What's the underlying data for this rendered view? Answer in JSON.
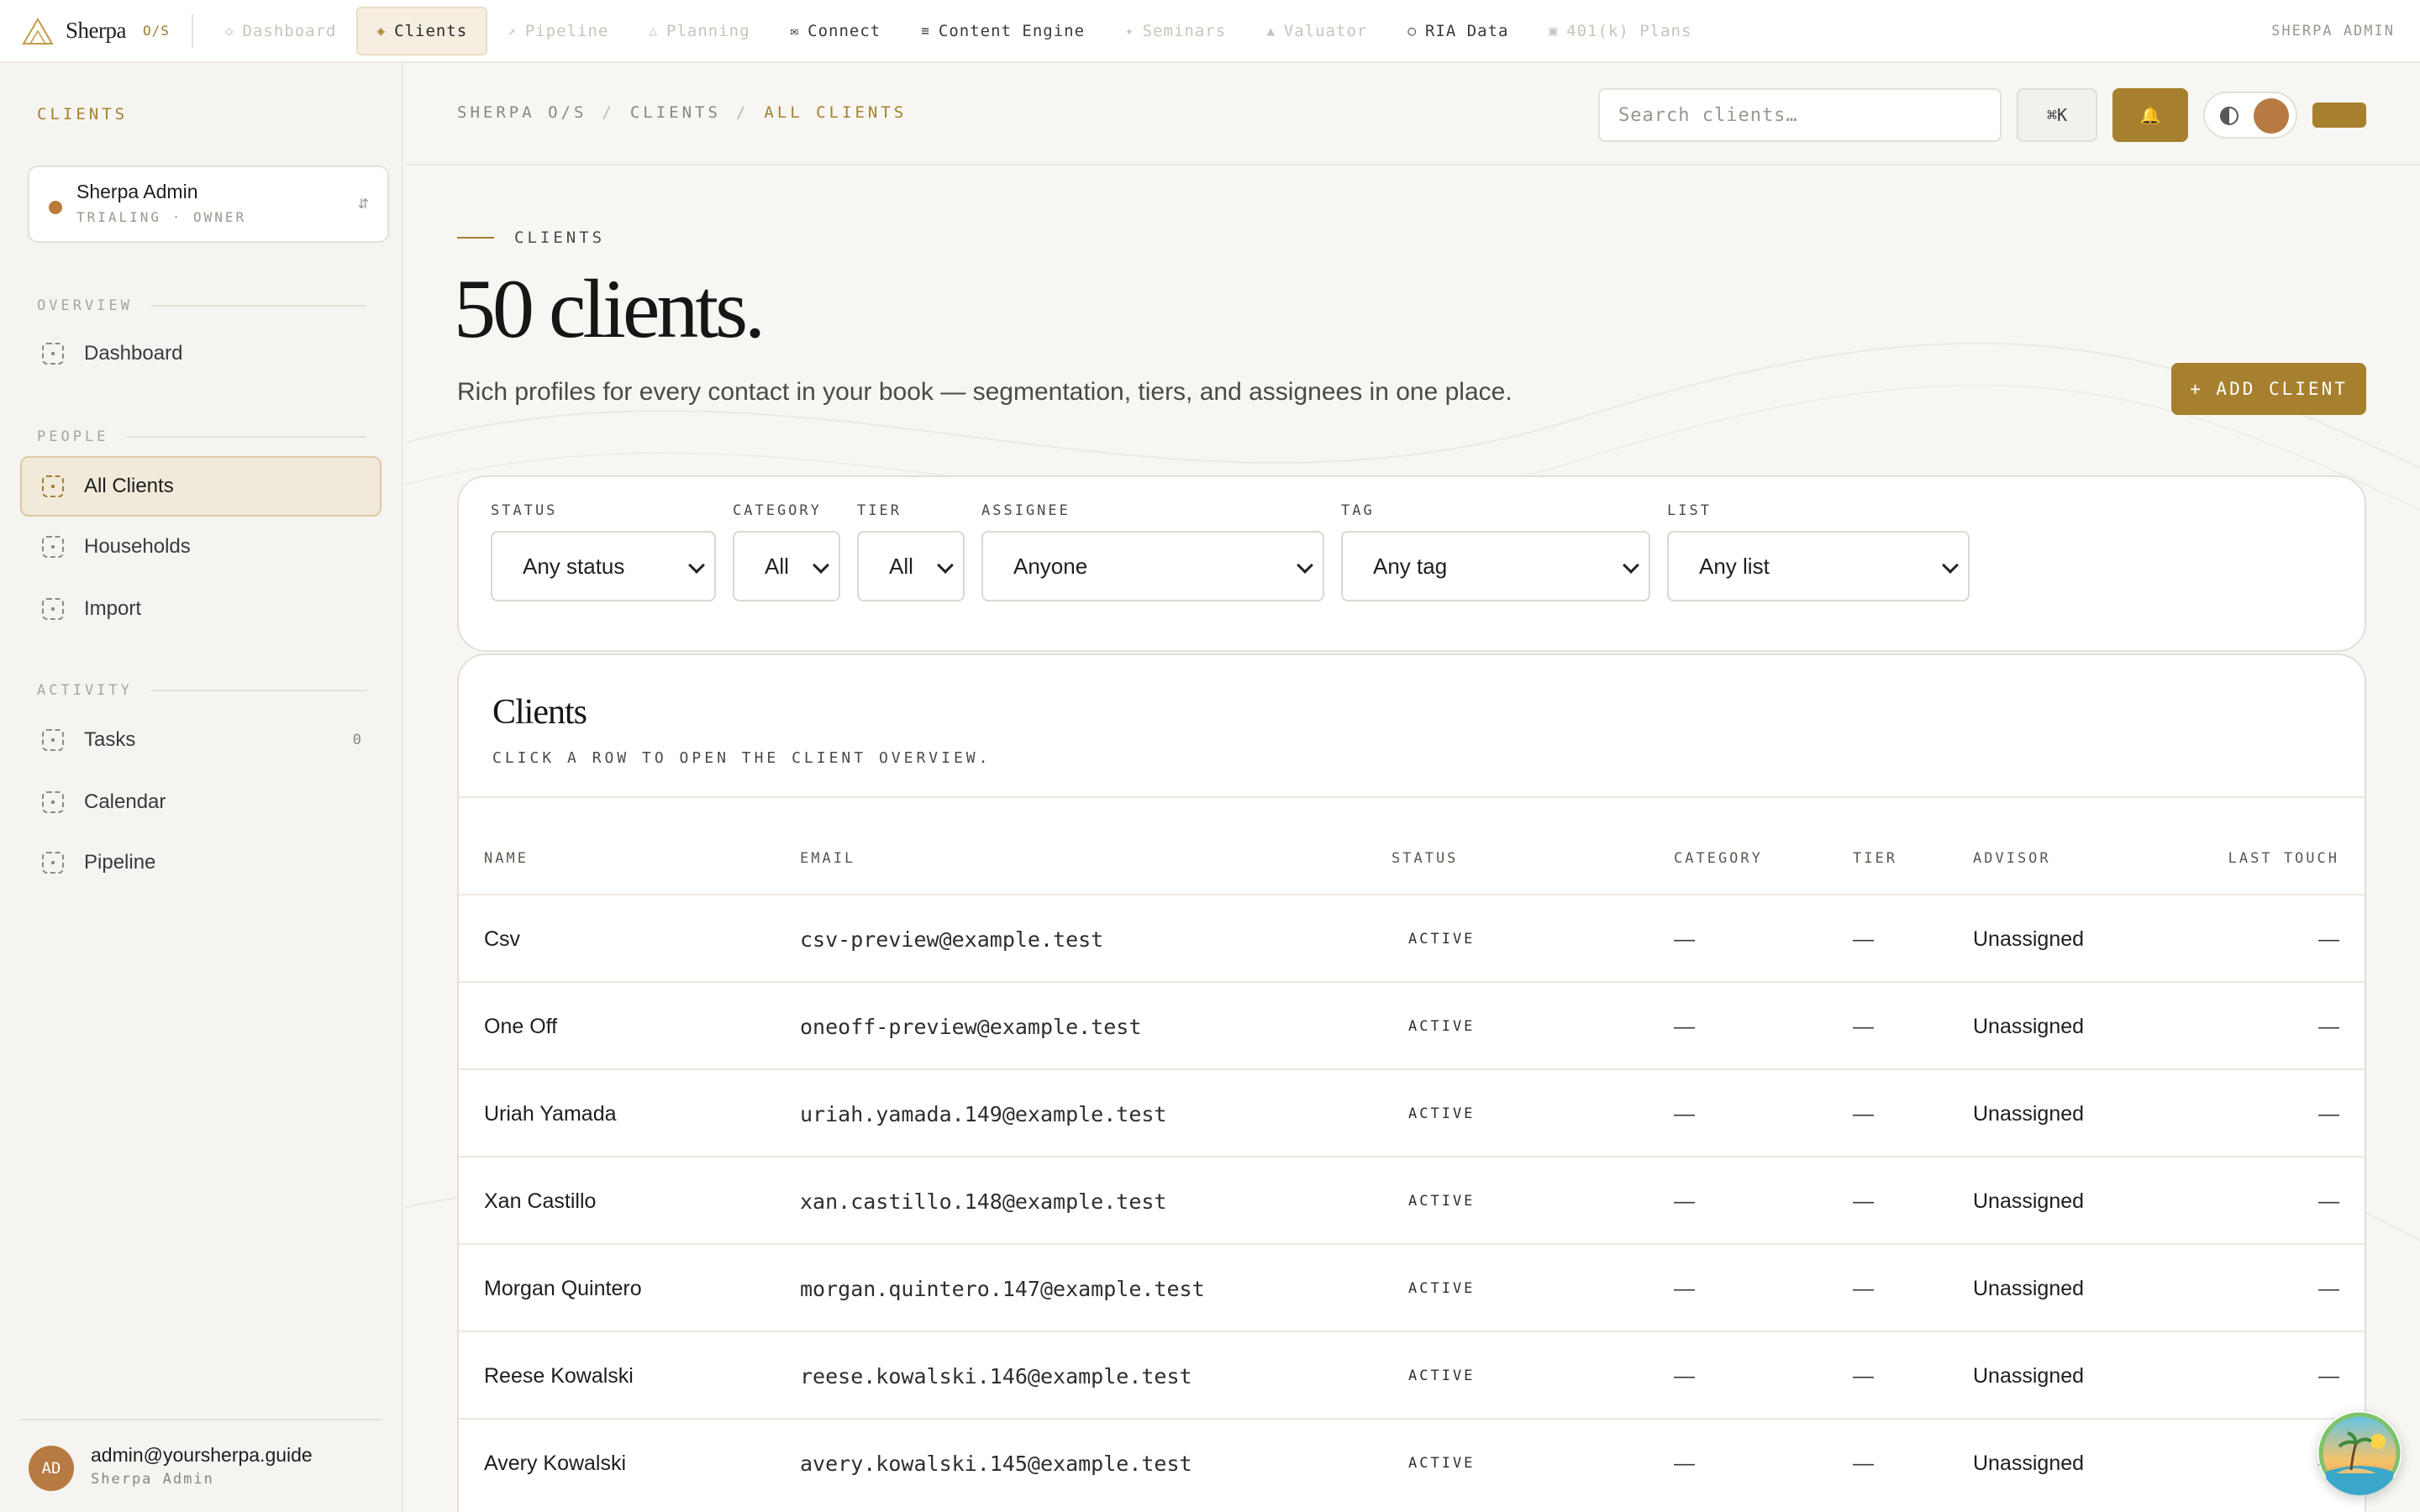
{
  "brand": {
    "name": "Sherpa",
    "tag": "O/S"
  },
  "topnav": [
    {
      "label": "Dashboard",
      "icon": "◇",
      "state": "disabled"
    },
    {
      "label": "Clients",
      "icon": "◈",
      "state": "active"
    },
    {
      "label": "Pipeline",
      "icon": "↗",
      "state": "disabled"
    },
    {
      "label": "Planning",
      "icon": "△",
      "state": "disabled"
    },
    {
      "label": "Connect",
      "icon": "✉",
      "state": "enabled"
    },
    {
      "label": "Content Engine",
      "icon": "≡",
      "state": "enabled"
    },
    {
      "label": "Seminars",
      "icon": "✦",
      "state": "disabled"
    },
    {
      "label": "Valuator",
      "icon": "▲",
      "state": "disabled"
    },
    {
      "label": "RIA Data",
      "icon": "○",
      "state": "enabled"
    },
    {
      "label": "401(k) Plans",
      "icon": "▣",
      "state": "disabled"
    }
  ],
  "top_user": "SHERPA ADMIN",
  "sidebar": {
    "title": "CLIENTS",
    "org": {
      "name": "Sherpa Admin",
      "sub": "TRIALING · OWNER",
      "switch_icon": "⇵"
    },
    "sections": {
      "overview": "OVERVIEW",
      "people": "PEOPLE",
      "activity": "ACTIVITY"
    },
    "items": {
      "dashboard": "Dashboard",
      "all_clients": "All Clients",
      "households": "Households",
      "import": "Import",
      "tasks": "Tasks",
      "tasks_count": "0",
      "calendar": "Calendar",
      "pipeline": "Pipeline"
    },
    "footer": {
      "initials": "AD",
      "email": "admin@yoursherpa.guide",
      "role": "Sherpa Admin"
    }
  },
  "breadcrumb": [
    "SHERPA O/S",
    "CLIENTS",
    "ALL CLIENTS"
  ],
  "search": {
    "placeholder": "Search clients…"
  },
  "kbd": "⌘K",
  "bell": "🔔",
  "hero": {
    "eyebrow": "CLIENTS",
    "title": "50 clients.",
    "subtitle": "Rich profiles for every contact in your book — segmentation, tiers, and assignees in one place.",
    "add_button": "+ ADD CLIENT"
  },
  "filters": {
    "status": {
      "label": "STATUS",
      "value": "Any status"
    },
    "category": {
      "label": "CATEGORY",
      "value": "All"
    },
    "tier": {
      "label": "TIER",
      "value": "All"
    },
    "assignee": {
      "label": "ASSIGNEE",
      "value": "Anyone"
    },
    "tag": {
      "label": "TAG",
      "value": "Any tag"
    },
    "list": {
      "label": "LIST",
      "value": "Any list"
    }
  },
  "table": {
    "title": "Clients",
    "hint": "CLICK A ROW TO OPEN THE CLIENT OVERVIEW.",
    "columns": {
      "name": "NAME",
      "email": "EMAIL",
      "status": "STATUS",
      "category": "CATEGORY",
      "tier": "TIER",
      "advisor": "ADVISOR",
      "last_touch": "LAST TOUCH"
    },
    "rows": [
      {
        "name": "Csv",
        "email": "csv-preview@example.test",
        "status": "ACTIVE",
        "category": "—",
        "tier": "—",
        "advisor": "Unassigned",
        "last_touch": "—"
      },
      {
        "name": "One Off",
        "email": "oneoff-preview@example.test",
        "status": "ACTIVE",
        "category": "—",
        "tier": "—",
        "advisor": "Unassigned",
        "last_touch": "—"
      },
      {
        "name": "Uriah Yamada",
        "email": "uriah.yamada.149@example.test",
        "status": "ACTIVE",
        "category": "—",
        "tier": "—",
        "advisor": "Unassigned",
        "last_touch": "—"
      },
      {
        "name": "Xan Castillo",
        "email": "xan.castillo.148@example.test",
        "status": "ACTIVE",
        "category": "—",
        "tier": "—",
        "advisor": "Unassigned",
        "last_touch": "—"
      },
      {
        "name": "Morgan Quintero",
        "email": "morgan.quintero.147@example.test",
        "status": "ACTIVE",
        "category": "—",
        "tier": "—",
        "advisor": "Unassigned",
        "last_touch": "—"
      },
      {
        "name": "Reese Kowalski",
        "email": "reese.kowalski.146@example.test",
        "status": "ACTIVE",
        "category": "—",
        "tier": "—",
        "advisor": "Unassigned",
        "last_touch": "—"
      },
      {
        "name": "Avery Kowalski",
        "email": "avery.kowalski.145@example.test",
        "status": "ACTIVE",
        "category": "—",
        "tier": "—",
        "advisor": "Unassigned",
        "last_touch": "—"
      }
    ]
  },
  "colors": {
    "accent": "#a6802e",
    "avatar": "#b77a43",
    "background": "#f7f6f3"
  }
}
